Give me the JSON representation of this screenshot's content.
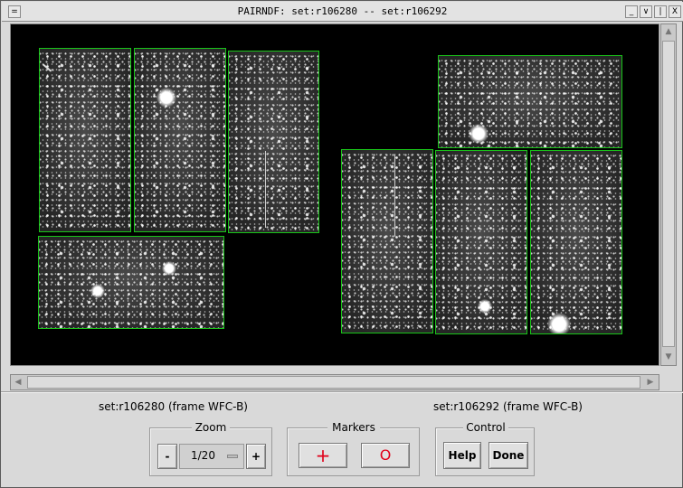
{
  "window": {
    "title": "PAIRNDF: set:r106280 -- set:r106292",
    "buttons": [
      "_",
      "∨",
      "|",
      "X"
    ]
  },
  "panels": {
    "left_label": "set:r106280 (frame WFC-B)",
    "right_label": "set:r106292 (frame WFC-B)"
  },
  "zoom": {
    "title": "Zoom",
    "minus": "-",
    "value": "1/20",
    "plus": "+"
  },
  "markers": {
    "title": "Markers",
    "cross": "+",
    "circle": "O"
  },
  "control": {
    "title": "Control",
    "help": "Help",
    "done": "Done"
  },
  "colors": {
    "outline": "#19c419",
    "marker": "#e0001a",
    "background": "#000000"
  },
  "icons": {
    "scroll_up": "triangle-up",
    "scroll_down": "triangle-down",
    "scroll_left": "triangle-left",
    "scroll_right": "triangle-right"
  }
}
